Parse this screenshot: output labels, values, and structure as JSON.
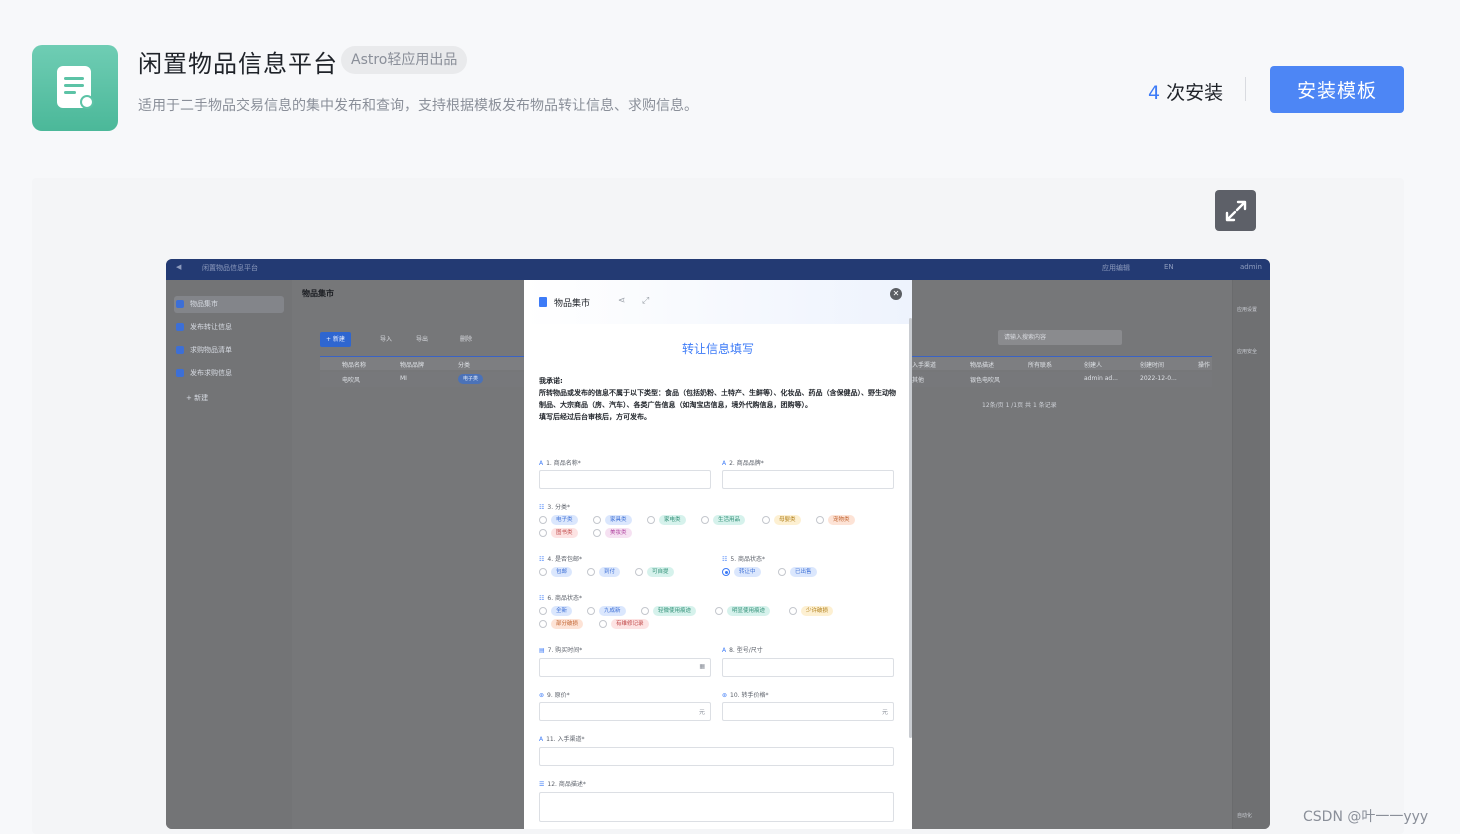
{
  "header": {
    "title": "闲置物品信息平台",
    "badge": "Astro轻应用出品",
    "description": "适用于二手物品交易信息的集中发布和查询，支持根据模板发布物品转让信息、求购信息。",
    "install_count": "4",
    "install_suffix": "次安装",
    "install_button": "安装模板",
    "accent_color": "#4d86f5"
  },
  "screenshot": {
    "topbar": {
      "app_name": "闲置物品信息平台",
      "right_items": [
        "应用编辑",
        "EN",
        "admin"
      ]
    },
    "sidebar": {
      "items": [
        {
          "label": "物品集市"
        },
        {
          "label": "发布转让信息"
        },
        {
          "label": "求购物品清单"
        },
        {
          "label": "发布求购信息"
        },
        {
          "label": "+ 新建"
        }
      ]
    },
    "main": {
      "title": "物品集市",
      "toolbar": [
        "+ 新建",
        "导入",
        "导出",
        "删除"
      ],
      "search_placeholder": "请输入搜索内容",
      "columns": [
        "物品名称",
        "物品品牌",
        "分类",
        "入手渠道",
        "物品描述",
        "所有联系",
        "创建人",
        "创建时间",
        "操作"
      ],
      "row": {
        "name": "电吹风",
        "brand": "MI",
        "category": "电子类",
        "channel": "其他",
        "desc": "银色电吹风",
        "creator": "admin ad...",
        "created": "2022-12-0..."
      },
      "pager": "12条/页  1  /1页 共 1 条记录",
      "right_panel": [
        "应用设置",
        "应用安全",
        "自动化"
      ]
    }
  },
  "modal": {
    "header_title": "物品集市",
    "form_title": "转让信息填写",
    "promise_lines": [
      "我承诺:",
      "所转物品或发布的信息不属于以下类型：食品（包括奶粉、土特产、生鲜等）、化妆品、药品（含保健品）、野生动物制品、大宗商品（房、汽车）、各类广告信息（如淘宝店信息，境外代购信息，团购等）。",
      "填写后经过后台审核后，方可发布。"
    ],
    "fields": {
      "f1": "1. 商品名称*",
      "f2": "2. 商品品牌*",
      "f3": "3. 分类*",
      "f4": "4. 是否包邮*",
      "f5": "5. 商品状态*",
      "f6": "6. 商品状态*",
      "f7": "7. 购买时间*",
      "f8": "8. 型号/尺寸",
      "f9": "9. 原价*",
      "f10": "10. 转手价格*",
      "f11": "11. 入手渠道*",
      "f12": "12. 商品描述*"
    },
    "yuan": "元",
    "category_options": [
      {
        "label": "电子类",
        "color": "#dbe7fd",
        "text": "#3d6fd6"
      },
      {
        "label": "家具类",
        "color": "#dbe7fd",
        "text": "#3d6fd6"
      },
      {
        "label": "家电类",
        "color": "#d6f2ec",
        "text": "#2f8f76"
      },
      {
        "label": "生活用品",
        "color": "#d6f2ec",
        "text": "#2f8f76"
      },
      {
        "label": "母婴类",
        "color": "#fdf0d2",
        "text": "#b07d16"
      },
      {
        "label": "宠物类",
        "color": "#fde3d6",
        "text": "#c0622e"
      },
      {
        "label": "图书类",
        "color": "#fde3e3",
        "text": "#c04848"
      },
      {
        "label": "美妆类",
        "color": "#f6e1f2",
        "text": "#b248a2"
      }
    ],
    "shipping_options": [
      {
        "label": "包邮",
        "color": "#dbe7fd",
        "text": "#3d6fd6"
      },
      {
        "label": "到付",
        "color": "#dbe7fd",
        "text": "#3d6fd6"
      },
      {
        "label": "可自提",
        "color": "#d6f2ec",
        "text": "#2f8f76"
      }
    ],
    "status_options": [
      {
        "label": "转让中",
        "color": "#dbe7fd",
        "text": "#3d6fd6",
        "selected": true
      },
      {
        "label": "已出售",
        "color": "#dbe7fd",
        "text": "#3d6fd6",
        "selected": false
      }
    ],
    "condition_options": [
      {
        "label": "全新",
        "color": "#dbe7fd",
        "text": "#3d6fd6"
      },
      {
        "label": "九成新",
        "color": "#dbe7fd",
        "text": "#3d6fd6"
      },
      {
        "label": "轻微使用痕迹",
        "color": "#d6f2ec",
        "text": "#2f8f76"
      },
      {
        "label": "明显使用痕迹",
        "color": "#d6f2ec",
        "text": "#2f8f76"
      },
      {
        "label": "少许破损",
        "color": "#fdf0d2",
        "text": "#b07d16"
      },
      {
        "label": "部分破损",
        "color": "#fde3d6",
        "text": "#c0622e"
      },
      {
        "label": "有维修记录",
        "color": "#fde3e3",
        "text": "#c04848"
      }
    ]
  },
  "watermark": "CSDN @叶一一yyy"
}
